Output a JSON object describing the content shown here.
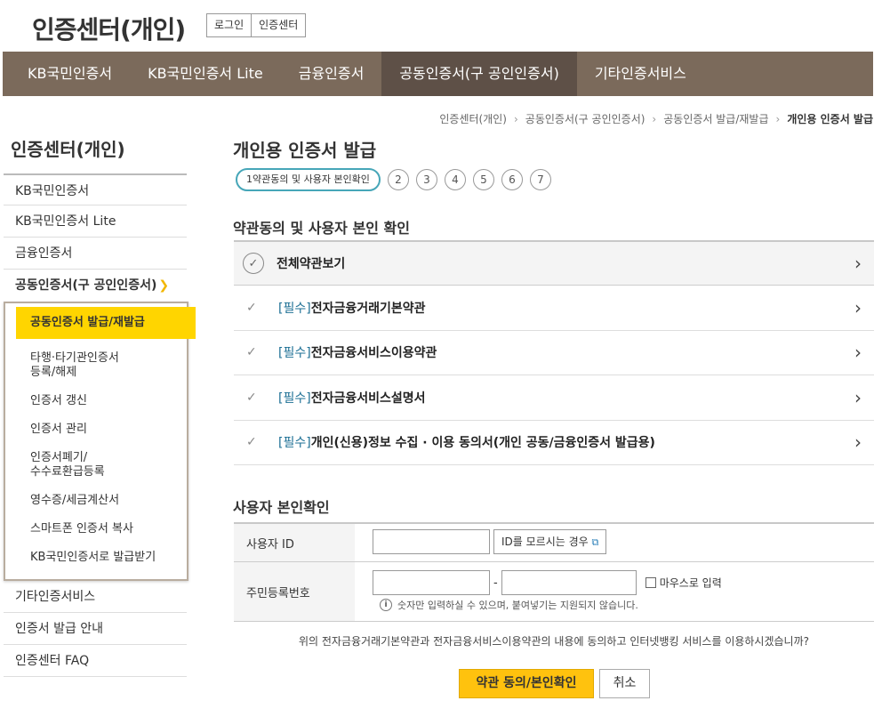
{
  "header": {
    "site_title": "인증센터(개인)",
    "top_links": [
      "로그인",
      "인증센터"
    ]
  },
  "gnb": {
    "items": [
      "KB국민인증서",
      "KB국민인증서 Lite",
      "금융인증서",
      "공동인증서(구 공인인증서)",
      "기타인증서비스"
    ],
    "active_index": 3
  },
  "breadcrumb": [
    "인증센터(개인)",
    "공동인증서(구 공인인증서)",
    "공동인증서 발급/재발급",
    "개인용 인증서 발급"
  ],
  "lnb": {
    "title": "인증센터(개인)",
    "items_top": [
      "KB국민인증서",
      "KB국민인증서 Lite",
      "금융인증서"
    ],
    "open_item": "공동인증서(구 공인인증서)",
    "sub_items": [
      "공동인증서 발급/재발급",
      "타행·타기관인증서\n등록/해제",
      "인증서 갱신",
      "인증서 관리",
      "인증서폐기/\n수수료환급등록",
      "영수증/세금계산서",
      "스마트폰 인증서 복사",
      "KB국민인증서로 발급받기"
    ],
    "items_bottom": [
      "기타인증서비스",
      "인증서 발급 안내",
      "인증센터 FAQ"
    ]
  },
  "main": {
    "page_title": "개인용 인증서 발급",
    "steps": {
      "active_label": "1약관동의 및 사용자 본인확인",
      "others": [
        "2",
        "3",
        "4",
        "5",
        "6",
        "7"
      ]
    },
    "terms_section_title": "약관동의 및 사용자 본인 확인",
    "all_terms_label": "전체약관보기",
    "required_tag": "[필수]",
    "terms": [
      "전자금융거래기본약관",
      "전자금융서비스이용약관",
      "전자금융서비스설명서",
      "개인(신용)정보 수집 · 이용 동의서(개인 공동/금융인증서 발급용)"
    ],
    "identity_section_title": "사용자 본인확인",
    "user_id_label": "사용자 ID",
    "find_id_button": "ID를 모르시는 경우",
    "rrn_label": "주민등록번호",
    "rrn_separator": "-",
    "mouse_input_label": "마우스로 입력",
    "rrn_note": "숫자만 입력하실 수 있으며, 붙여넣기는 지원되지 않습니다.",
    "agree_text": "위의 전자금융거래기본약관과 전자금융서비스이용약관의 내용에 동의하고 인터넷뱅킹 서비스를 이용하시겠습니까?",
    "confirm_button": "약관 동의/본인확인",
    "cancel_button": "취소"
  }
}
